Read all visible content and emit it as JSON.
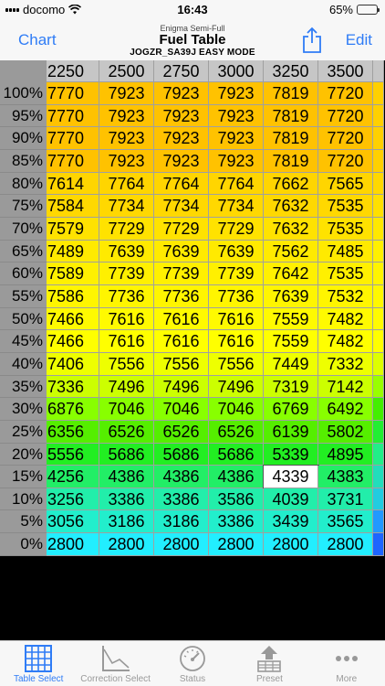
{
  "status": {
    "carrier": "docomo",
    "time": "16:43",
    "battery": "65%",
    "battery_level": 0.65
  },
  "nav": {
    "left": "Chart",
    "right": "Edit",
    "subtitle": "Enigma Semi-Full",
    "title": "Fuel Table",
    "mode": "JOGZR_SA39J EASY MODE"
  },
  "table": {
    "columns": [
      "2250",
      "2500",
      "2750",
      "3000",
      "3250",
      "3500",
      ""
    ],
    "rows": [
      {
        "label": "100%",
        "values": [
          "7770",
          "7923",
          "7923",
          "7923",
          "7819",
          "7720",
          ""
        ]
      },
      {
        "label": "95%",
        "values": [
          "7770",
          "7923",
          "7923",
          "7923",
          "7819",
          "7720",
          ""
        ]
      },
      {
        "label": "90%",
        "values": [
          "7770",
          "7923",
          "7923",
          "7923",
          "7819",
          "7720",
          ""
        ]
      },
      {
        "label": "85%",
        "values": [
          "7770",
          "7923",
          "7923",
          "7923",
          "7819",
          "7720",
          ""
        ]
      },
      {
        "label": "80%",
        "values": [
          "7614",
          "7764",
          "7764",
          "7764",
          "7662",
          "7565",
          ""
        ]
      },
      {
        "label": "75%",
        "values": [
          "7584",
          "7734",
          "7734",
          "7734",
          "7632",
          "7535",
          ""
        ]
      },
      {
        "label": "70%",
        "values": [
          "7579",
          "7729",
          "7729",
          "7729",
          "7632",
          "7535",
          ""
        ]
      },
      {
        "label": "65%",
        "values": [
          "7489",
          "7639",
          "7639",
          "7639",
          "7562",
          "7485",
          ""
        ]
      },
      {
        "label": "60%",
        "values": [
          "7589",
          "7739",
          "7739",
          "7739",
          "7642",
          "7535",
          ""
        ]
      },
      {
        "label": "55%",
        "values": [
          "7586",
          "7736",
          "7736",
          "7736",
          "7639",
          "7532",
          ""
        ]
      },
      {
        "label": "50%",
        "values": [
          "7466",
          "7616",
          "7616",
          "7616",
          "7559",
          "7482",
          ""
        ]
      },
      {
        "label": "45%",
        "values": [
          "7466",
          "7616",
          "7616",
          "7616",
          "7559",
          "7482",
          ""
        ]
      },
      {
        "label": "40%",
        "values": [
          "7406",
          "7556",
          "7556",
          "7556",
          "7449",
          "7332",
          ""
        ]
      },
      {
        "label": "35%",
        "values": [
          "7336",
          "7496",
          "7496",
          "7496",
          "7319",
          "7142",
          ""
        ]
      },
      {
        "label": "30%",
        "values": [
          "6876",
          "7046",
          "7046",
          "7046",
          "6769",
          "6492",
          ""
        ]
      },
      {
        "label": "25%",
        "values": [
          "6356",
          "6526",
          "6526",
          "6526",
          "6139",
          "5802",
          ""
        ]
      },
      {
        "label": "20%",
        "values": [
          "5556",
          "5686",
          "5686",
          "5686",
          "5339",
          "4895",
          ""
        ]
      },
      {
        "label": "15%",
        "values": [
          "4256",
          "4386",
          "4386",
          "4386",
          "4339",
          "4383",
          ""
        ]
      },
      {
        "label": "10%",
        "values": [
          "3256",
          "3386",
          "3386",
          "3586",
          "4039",
          "3731",
          ""
        ]
      },
      {
        "label": "5%",
        "values": [
          "3056",
          "3186",
          "3186",
          "3386",
          "3439",
          "3565",
          ""
        ]
      },
      {
        "label": "0%",
        "values": [
          "2800",
          "2800",
          "2800",
          "2800",
          "2800",
          "2800",
          ""
        ]
      }
    ],
    "row_colors": [
      "#ffc200",
      "#ffc200",
      "#ffc200",
      "#ffc200",
      "#ffd500",
      "#ffd800",
      "#ffe200",
      "#ffea00",
      "#fff000",
      "#fff500",
      "#fffa00",
      "#ffff00",
      "#eeff00",
      "#ccff00",
      "#88ff00",
      "#55ee00",
      "#22ee22",
      "#22ee66",
      "#22eeaa",
      "#22eecc",
      "#22eeff"
    ],
    "selected": {
      "row": 17,
      "col": 4
    },
    "last_col_colors": [
      "#ffd000",
      "#ffd000",
      "#ffd000",
      "#ffd000",
      "#ffd800",
      "#ffe000",
      "#ffe800",
      "#fff000",
      "#fff400",
      "#fff800",
      "#fffb00",
      "#ffff00",
      "#ddff00",
      "#99ff00",
      "#44ee00",
      "#22ee33",
      "#22ee88",
      "#22ddbb",
      "#22cce0",
      "#2299ff",
      "#1e66ff"
    ]
  },
  "tabs": [
    {
      "label": "Table Select",
      "icon": "grid-icon",
      "active": true
    },
    {
      "label": "Correction Select",
      "icon": "chart-line-icon",
      "active": false
    },
    {
      "label": "Status",
      "icon": "gauge-icon",
      "active": false
    },
    {
      "label": "Preset",
      "icon": "preset-icon",
      "active": false
    },
    {
      "label": "More",
      "icon": "more-icon",
      "active": false
    }
  ],
  "colors": {
    "accent": "#2f7cf6",
    "header": "#9a9a9a"
  }
}
